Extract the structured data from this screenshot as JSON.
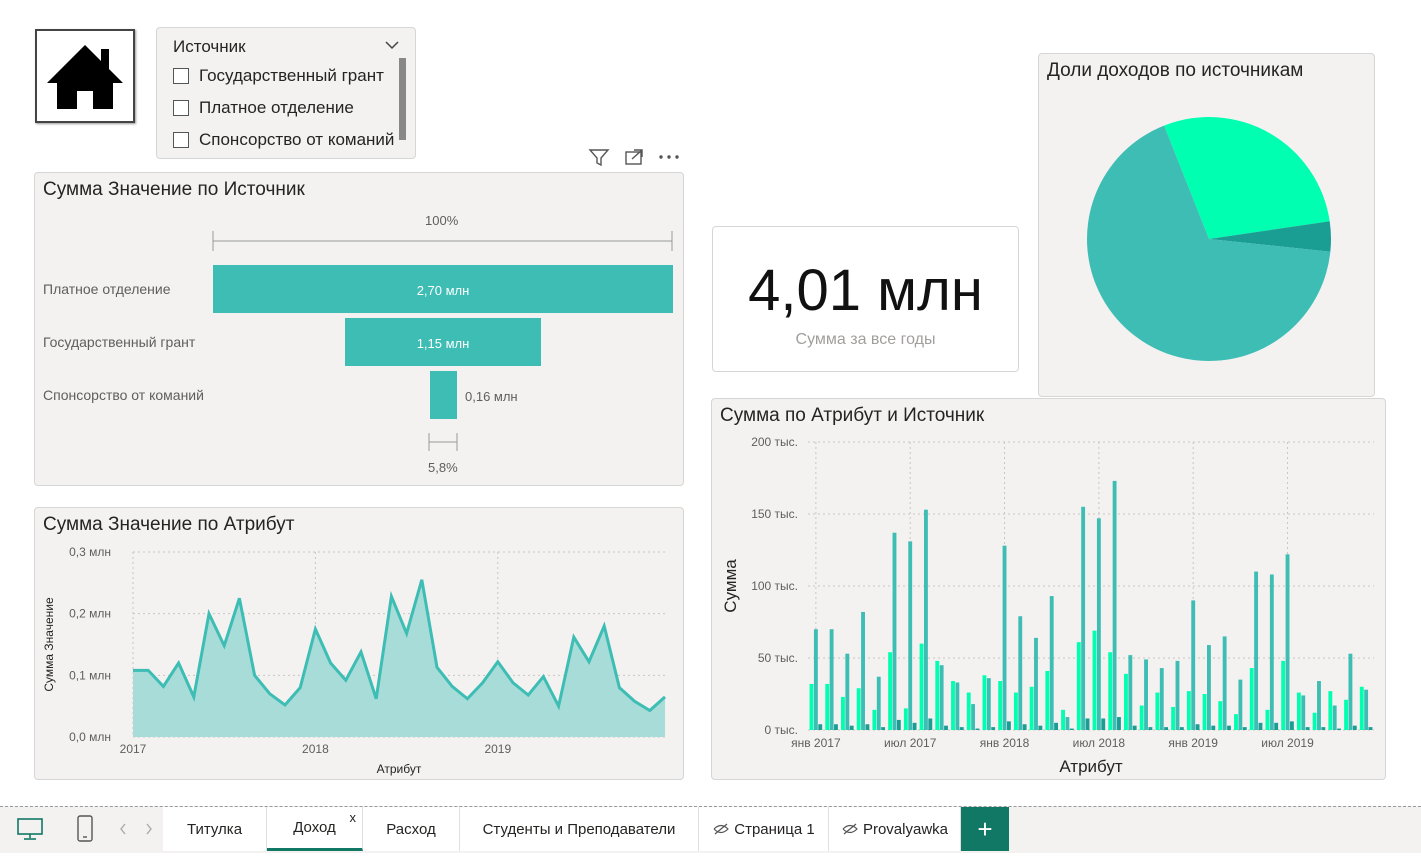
{
  "slicer": {
    "title": "Источник",
    "items": [
      "Государственный грант",
      "Платное отделение",
      "Спонсорство от команий"
    ]
  },
  "funnel": {
    "title": "Сумма Значение по Источник",
    "top_pct": "100%",
    "bottom_pct": "5,8%",
    "rows": [
      {
        "label": "Платное отделение",
        "value_label": "2,70 млн",
        "value": 2.7
      },
      {
        "label": "Государственный грант",
        "value_label": "1,15 млн",
        "value": 1.15
      },
      {
        "label": "Спонсорство от команий",
        "value_label": "0,16 млн",
        "value": 0.16
      }
    ]
  },
  "kpi": {
    "value": "4,01 млн",
    "label": "Сумма за все годы"
  },
  "pie_title": "Доли доходов по источникам",
  "area_title": "Сумма Значение по Атрибут",
  "bar_title": "Сумма по Атрибут и Источник",
  "tabs": [
    {
      "label": "Титулка"
    },
    {
      "label": "Доход",
      "close": "x"
    },
    {
      "label": "Расход"
    },
    {
      "label": "Студенты и Преподаватели"
    },
    {
      "label": "Страница 1"
    },
    {
      "label": "Provalyawka"
    }
  ],
  "add_tab": "+",
  "colors": {
    "teal": "#3dbdb4",
    "mint": "#00ffb0",
    "dark_teal": "#1a9e94",
    "area_fill": "#a8dcd8",
    "accent": "#117865"
  },
  "chart_data": [
    {
      "type": "pie",
      "title": "Доли доходов по источникам",
      "slices": [
        {
          "value": 2.7,
          "color": "#3dbdb4"
        },
        {
          "value": 1.15,
          "color": "#00ffb0"
        },
        {
          "value": 0.16,
          "color": "#1a9e94"
        }
      ]
    },
    {
      "type": "area",
      "title": "Сумма Значение по Атрибут",
      "xlabel": "Атрибут",
      "ylabel": "Сумма Значение",
      "x_ticks": [
        "2017",
        "2018",
        "2019"
      ],
      "y_ticks": [
        "0,0 млн",
        "0,1 млн",
        "0,2 млн",
        "0,3 млн"
      ],
      "ylim": [
        0,
        0.3
      ],
      "values": [
        0.108,
        0.108,
        0.082,
        0.12,
        0.065,
        0.2,
        0.148,
        0.225,
        0.1,
        0.07,
        0.052,
        0.08,
        0.175,
        0.12,
        0.092,
        0.138,
        0.062,
        0.228,
        0.168,
        0.255,
        0.113,
        0.082,
        0.062,
        0.088,
        0.122,
        0.088,
        0.068,
        0.098,
        0.05,
        0.162,
        0.122,
        0.18,
        0.08,
        0.058,
        0.043,
        0.065
      ]
    },
    {
      "type": "bar",
      "title": "Сумма по Атрибут и Источник",
      "xlabel": "Атрибут",
      "ylabel": "Сумма",
      "x_ticks": [
        "янв 2017",
        "июл 2017",
        "янв 2018",
        "июл 2018",
        "янв 2019",
        "июл 2019"
      ],
      "y_ticks": [
        "0 тыс.",
        "50 тыс.",
        "100 тыс.",
        "150 тыс.",
        "200 тыс."
      ],
      "ylim": [
        0,
        200
      ],
      "series": [
        {
          "color": "#00ffb0",
          "values": [
            32,
            32,
            23,
            29,
            14,
            54,
            15,
            60,
            48,
            34,
            26,
            38,
            34,
            26,
            30,
            41,
            14,
            61,
            69,
            54,
            39,
            17,
            26,
            16,
            27,
            25,
            20,
            11,
            43,
            14,
            48,
            26,
            12,
            27,
            21,
            30
          ]
        },
        {
          "color": "#3dbdb4",
          "values": [
            70,
            70,
            53,
            82,
            37,
            137,
            131,
            153,
            45,
            33,
            18,
            36,
            128,
            79,
            64,
            93,
            9,
            155,
            147,
            173,
            52,
            49,
            43,
            48,
            90,
            59,
            65,
            35,
            110,
            108,
            122,
            24,
            34,
            17,
            53,
            28
          ]
        },
        {
          "color": "#1a9e94",
          "values": [
            4,
            4,
            3,
            4,
            2,
            7,
            5,
            8,
            3,
            2,
            1,
            2,
            6,
            4,
            3,
            5,
            1,
            8,
            8,
            9,
            3,
            2,
            2,
            2,
            4,
            3,
            3,
            2,
            5,
            5,
            6,
            2,
            2,
            1,
            3,
            2
          ]
        }
      ]
    }
  ]
}
